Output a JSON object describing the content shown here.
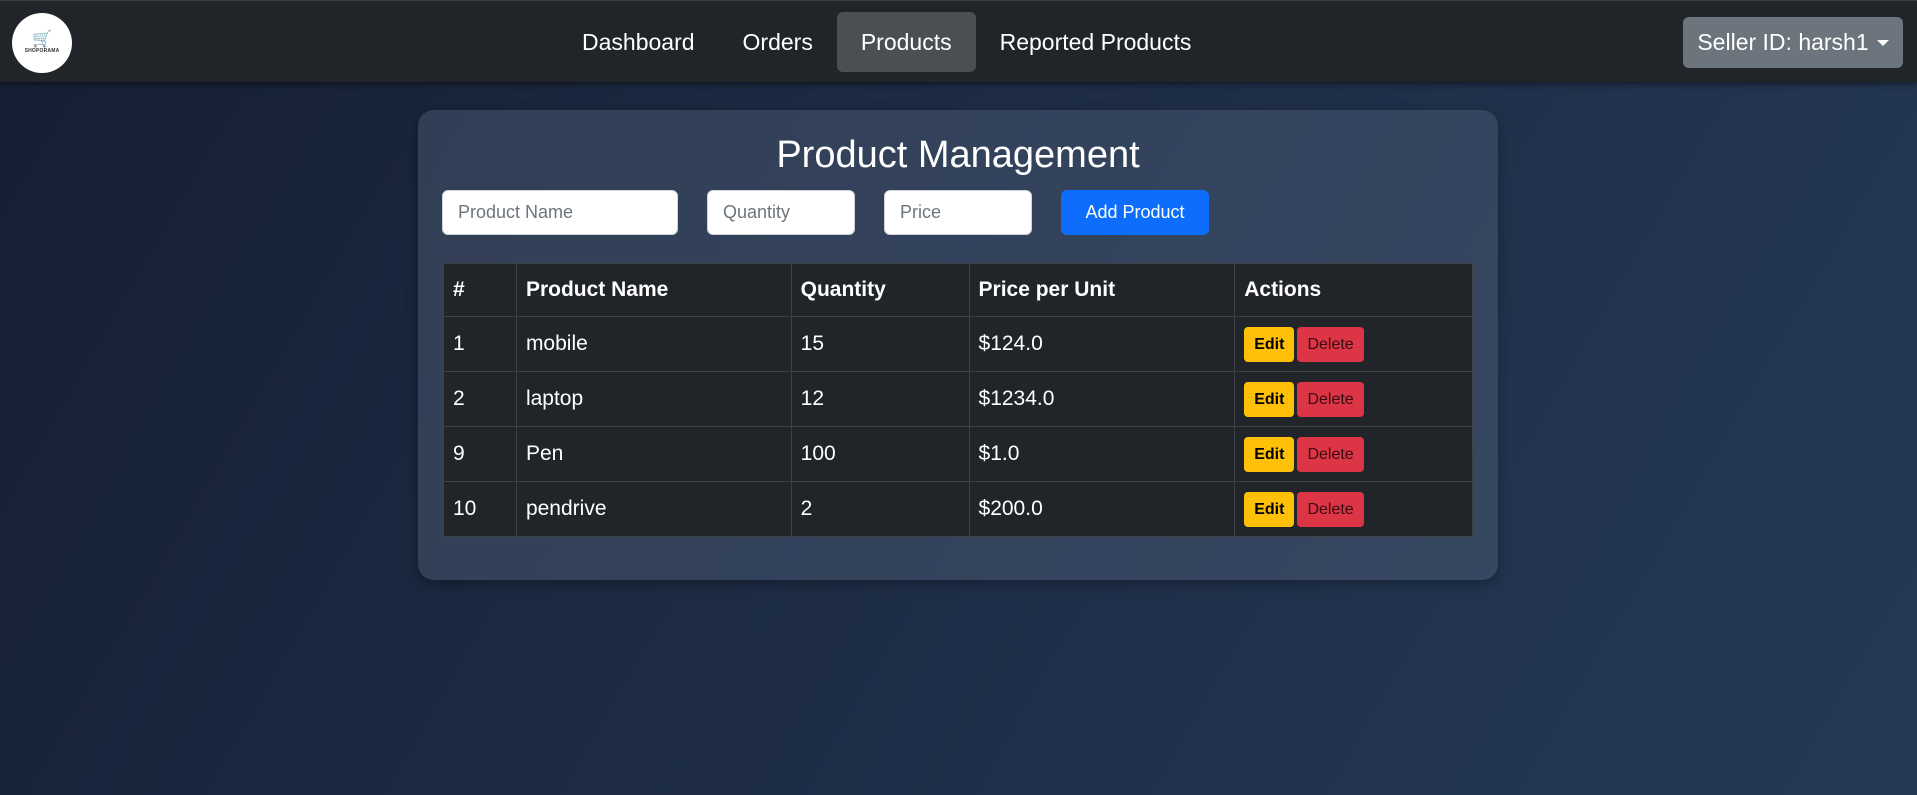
{
  "navbar": {
    "logo": {
      "icon": "shopping-cart-icon",
      "brand": "SHOPORAMA",
      "tagline": ""
    },
    "links": [
      {
        "label": "Dashboard",
        "active": false
      },
      {
        "label": "Orders",
        "active": false
      },
      {
        "label": "Products",
        "active": true
      },
      {
        "label": "Reported Products",
        "active": false
      }
    ],
    "seller_button": "Seller ID: harsh1"
  },
  "main": {
    "title": "Product Management",
    "form": {
      "name_placeholder": "Product Name",
      "quantity_placeholder": "Quantity",
      "price_placeholder": "Price",
      "add_label": "Add Product"
    },
    "table": {
      "columns": [
        "#",
        "Product Name",
        "Quantity",
        "Price per Unit",
        "Actions"
      ],
      "rows": [
        {
          "id": "1",
          "name": "mobile",
          "quantity": "15",
          "price": "$124.0"
        },
        {
          "id": "2",
          "name": "laptop",
          "quantity": "12",
          "price": "$1234.0"
        },
        {
          "id": "9",
          "name": "Pen",
          "quantity": "100",
          "price": "$1.0"
        },
        {
          "id": "10",
          "name": "pendrive",
          "quantity": "2",
          "price": "$200.0"
        }
      ],
      "edit_label": "Edit",
      "delete_label": "Delete"
    }
  },
  "colors": {
    "navbar_bg": "#212529",
    "primary": "#0d6efd",
    "warning": "#ffc107",
    "danger": "#dc3545",
    "secondary": "#6c757d"
  }
}
